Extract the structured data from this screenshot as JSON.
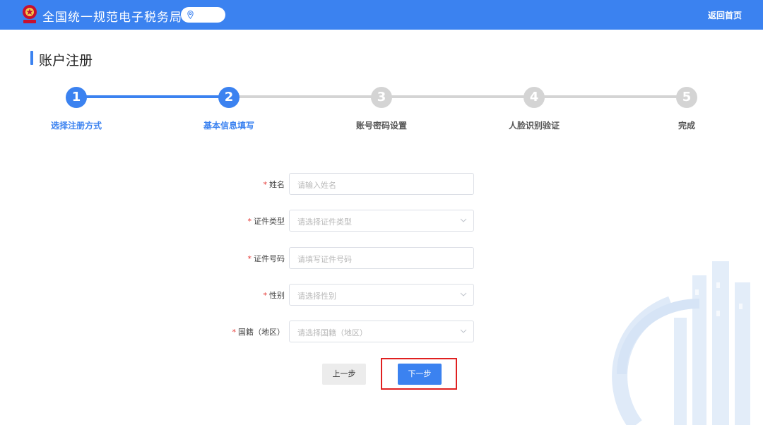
{
  "header": {
    "title": "全国统一规范电子税务局",
    "home_link": "返回首页",
    "logo_icon": "tax-emblem-icon",
    "location_icon": "location-pin-icon"
  },
  "page": {
    "title": "账户注册"
  },
  "steps": [
    {
      "number": "1",
      "label": "选择注册方式",
      "state": "done"
    },
    {
      "number": "2",
      "label": "基本信息填写",
      "state": "active"
    },
    {
      "number": "3",
      "label": "账号密码设置",
      "state": "pending"
    },
    {
      "number": "4",
      "label": "人脸识别验证",
      "state": "pending"
    },
    {
      "number": "5",
      "label": "完成",
      "state": "pending"
    }
  ],
  "form": {
    "required_mark": "*",
    "fields": [
      {
        "label": "姓名",
        "placeholder": "请输入姓名",
        "type": "text"
      },
      {
        "label": "证件类型",
        "placeholder": "请选择证件类型",
        "type": "select"
      },
      {
        "label": "证件号码",
        "placeholder": "请填写证件号码",
        "type": "text"
      },
      {
        "label": "性别",
        "placeholder": "请选择性别",
        "type": "select"
      },
      {
        "label": "国籍（地区）",
        "placeholder": "请选择国籍（地区）",
        "type": "select"
      }
    ]
  },
  "buttons": {
    "prev": "上一步",
    "next": "下一步"
  },
  "colors": {
    "primary": "#3b82f0",
    "inactive": "#d4d4d4",
    "highlight": "#e02020"
  }
}
